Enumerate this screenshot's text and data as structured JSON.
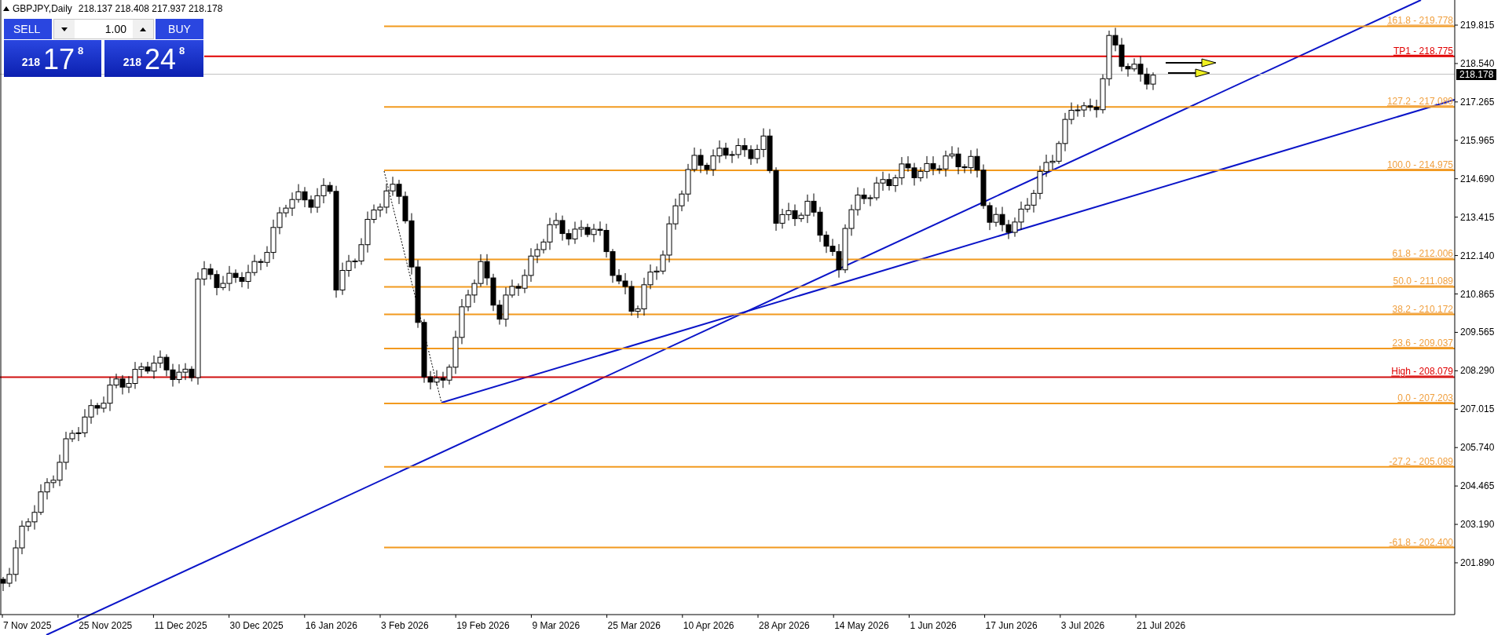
{
  "header": {
    "caption": "GBPJPY,Daily",
    "ohlc": "218.137 218.408 217.937 218.178"
  },
  "trade_panel": {
    "sell_label": "SELL",
    "buy_label": "BUY",
    "lot": "1.00",
    "sell_quote": {
      "prefix": "218",
      "main": "17",
      "sup": "8"
    },
    "buy_quote": {
      "prefix": "218",
      "main": "24",
      "sup": "8"
    }
  },
  "chart": {
    "price_axis": [
      "219.815",
      "218.540",
      "217.265",
      "215.965",
      "214.690",
      "213.415",
      "212.140",
      "210.865",
      "209.565",
      "208.290",
      "207.015",
      "205.740",
      "204.465",
      "203.190",
      "201.890"
    ],
    "current_price": "218.178",
    "time_axis": [
      "7 Nov 2025",
      "25 Nov 2025",
      "11 Dec 2025",
      "30 Dec 2025",
      "16 Jan 2026",
      "3 Feb 2026",
      "19 Feb 2026",
      "9 Mar 2026",
      "25 Mar 2026",
      "10 Apr 2026",
      "28 Apr 2026",
      "14 May 2026",
      "1 Jun 2026",
      "17 Jun 2026",
      "3 Jul 2026",
      "21 Jul 2026"
    ],
    "levels": [
      {
        "kind": "fib",
        "label": "161.8 - 219.778"
      },
      {
        "kind": "target",
        "label": "TP1 - 218.775"
      },
      {
        "kind": "fib",
        "label": "127.2 - 217.089"
      },
      {
        "kind": "fib",
        "label": "100.0 - 214.975"
      },
      {
        "kind": "fib",
        "label": "61.8 - 212.006"
      },
      {
        "kind": "fib",
        "label": "50.0 - 211.089"
      },
      {
        "kind": "fib",
        "label": "38.2 - 210.172"
      },
      {
        "kind": "fib",
        "label": "23.6 - 209.037"
      },
      {
        "kind": "high",
        "label": "High - 208.079"
      },
      {
        "kind": "fib",
        "label": "0.0 - 207.203"
      },
      {
        "kind": "fib",
        "label": "-27.2 - 205.089"
      },
      {
        "kind": "fib",
        "label": "-61.8 - 202.400"
      }
    ]
  }
}
